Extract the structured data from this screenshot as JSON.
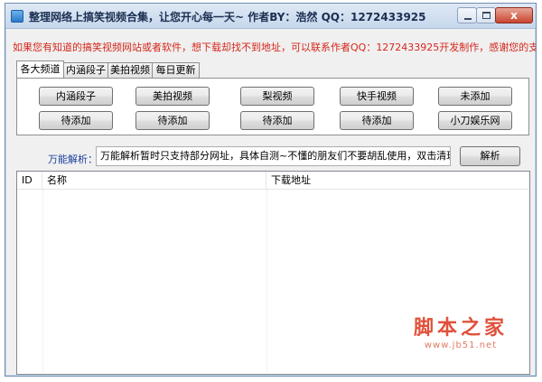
{
  "window": {
    "title": "整理网络上搞笑视频合集，让您开心每一天~ 作者BY：浩然 QQ：1272433925",
    "close_label": "x"
  },
  "notice": "如果您有知道的搞笑视频网站或者软件，想下载却找不到地址，可以联系作者QQ：1272433925开发制作，感谢您的支持~",
  "tabs": [
    "各大频道",
    "内涵段子",
    "美拍视频",
    "每日更新"
  ],
  "active_tab": 0,
  "buttons": {
    "row1": [
      "内涵段子",
      "美拍视频",
      "梨视频",
      "快手视频",
      "未添加"
    ],
    "row2": [
      "待添加",
      "待添加",
      "待添加",
      "待添加",
      "小刀娱乐网"
    ]
  },
  "parse": {
    "label": "万能解析：",
    "input_value": "万能解析暂时只支持部分网址，具体自测~不懂的朋友们不要胡乱使用，双击清理~",
    "button_label": "解析"
  },
  "table": {
    "columns": [
      "ID",
      "名称",
      "下载地址"
    ],
    "rows": []
  },
  "watermark": {
    "title": "脚本之家",
    "url": "www.jb51.net"
  },
  "colors": {
    "notice": "#d4271b",
    "parse_label": "#1d3f9c",
    "watermark": "#e0513b"
  }
}
